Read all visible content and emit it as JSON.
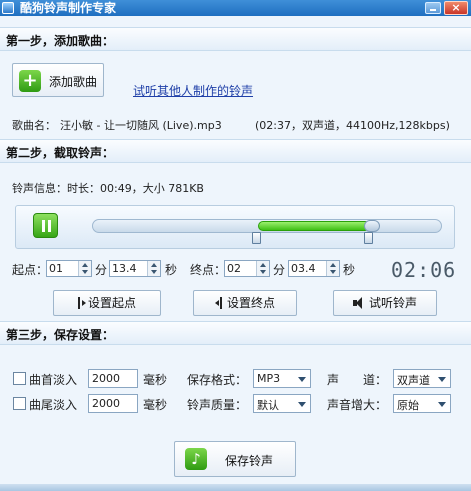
{
  "window": {
    "title": "酷狗铃声制作专家",
    "close_glyph": "×"
  },
  "step1": {
    "heading": "第一步，添加歌曲：",
    "add_button": "添加歌曲",
    "add_icon_glyph": "+",
    "listen_link": "试听其他人制作的铃声",
    "song_label": "歌曲名：",
    "song_name": "汪小敏 - 让一切随风 (Live).mp3",
    "song_info": "(02:37，双声道，44100Hz,128kbps)"
  },
  "step2": {
    "heading": "第二步，截取铃声：",
    "ringtone_info": "铃声信息：时长：00:49，大小 781KB",
    "selection": {
      "start_fraction": 0.47,
      "end_fraction": 0.79
    },
    "start_label": "起点：",
    "end_label": "终点：",
    "start": {
      "min": "01",
      "sec": "13.4"
    },
    "end": {
      "min": "02",
      "sec": "03.4"
    },
    "unit_min": "分",
    "unit_sec": "秒",
    "clock": "02:06",
    "buttons": {
      "set_start": "设置起点",
      "set_end": "设置终点",
      "preview": "试听铃声"
    }
  },
  "step3": {
    "heading": "第三步，保存设置：",
    "fade_in_label": "曲首淡入",
    "fade_in_value": "2000",
    "fade_out_label": "曲尾淡入",
    "fade_out_value": "2000",
    "ms_unit": "毫秒",
    "format_label": "保存格式：",
    "format_value": "MP3",
    "quality_label": "铃声质量：",
    "quality_value": "默认",
    "channel_label": "声　　道：",
    "channel_value": "双声道",
    "volume_label": "声音增大：",
    "volume_value": "原始",
    "save_button": "保存铃声",
    "save_icon_glyph": "♪"
  }
}
